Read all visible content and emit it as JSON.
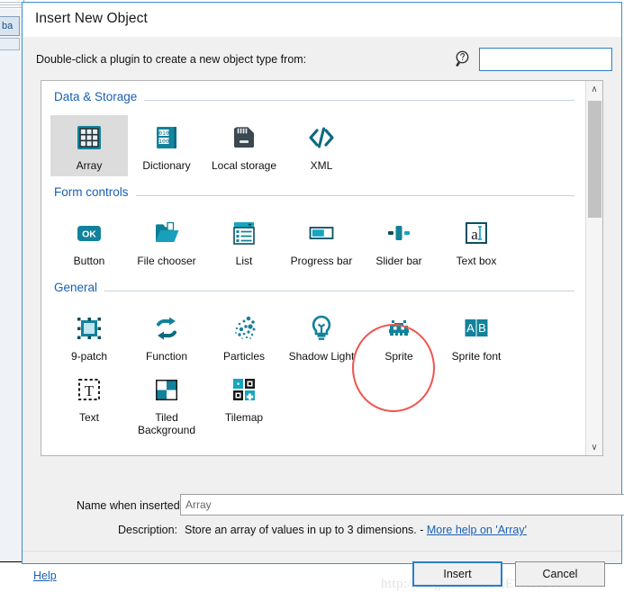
{
  "window": {
    "title": "Insert New Object",
    "background_tab_label": "ba"
  },
  "instruction": "Double-click a plugin to create a new object type from:",
  "search": {
    "icon": "magnifier-question-icon",
    "value": "",
    "placeholder": ""
  },
  "sections": [
    {
      "title": "Data & Storage",
      "plugins": [
        {
          "label": "Array",
          "icon": "grid-icon",
          "selected": true
        },
        {
          "label": "Dictionary",
          "icon": "book-binary-icon",
          "selected": false
        },
        {
          "label": "Local storage",
          "icon": "storage-drive-icon",
          "selected": false
        },
        {
          "label": "XML",
          "icon": "code-brackets-icon",
          "selected": false
        }
      ]
    },
    {
      "title": "Form controls",
      "plugins": [
        {
          "label": "Button",
          "icon": "ok-button-icon",
          "selected": false
        },
        {
          "label": "File chooser",
          "icon": "open-folder-icon",
          "selected": false
        },
        {
          "label": "List",
          "icon": "list-dropdown-icon",
          "selected": false
        },
        {
          "label": "Progress bar",
          "icon": "progress-bar-icon",
          "selected": false
        },
        {
          "label": "Slider bar",
          "icon": "slider-bar-icon",
          "selected": false
        },
        {
          "label": "Text box",
          "icon": "text-box-icon",
          "selected": false
        }
      ]
    },
    {
      "title": "General",
      "plugins": [
        {
          "label": "9-patch",
          "icon": "nine-patch-icon",
          "selected": false
        },
        {
          "label": "Function",
          "icon": "loop-arrows-icon",
          "selected": false
        },
        {
          "label": "Particles",
          "icon": "particles-icon",
          "selected": false
        },
        {
          "label": "Shadow Light",
          "icon": "lightbulb-icon",
          "selected": false
        },
        {
          "label": "Sprite",
          "icon": "space-invader-icon",
          "selected": false,
          "annotated": true
        },
        {
          "label": "Sprite font",
          "icon": "ab-letters-icon",
          "selected": false
        },
        {
          "label": "Text",
          "icon": "dashed-t-icon",
          "selected": false
        },
        {
          "label": "Tiled Background",
          "icon": "checker-tile-icon",
          "selected": false
        },
        {
          "label": "Tilemap",
          "icon": "tilemap-icon",
          "selected": false
        }
      ]
    }
  ],
  "scrollbar": {
    "up_arrow": "∧",
    "down_arrow": "∨"
  },
  "fields": {
    "name_label": "Name when inserted:",
    "name_value": "Array",
    "description_label": "Description:",
    "description_text": "Store an array of values in up to 3 dimensions. - ",
    "description_link": "More help on 'Array'"
  },
  "footer": {
    "help_label": "Help",
    "insert_label": "Insert",
    "cancel_label": "Cancel"
  },
  "watermark": "http://blog.csdn.net/ZETARUN",
  "colors": {
    "accent_teal": "#11829b",
    "title_blue": "#1a5fb4",
    "focus_blue": "#2a7fc9",
    "annotation_red": "#f0534f",
    "selection_gray": "#dcdcdc"
  }
}
